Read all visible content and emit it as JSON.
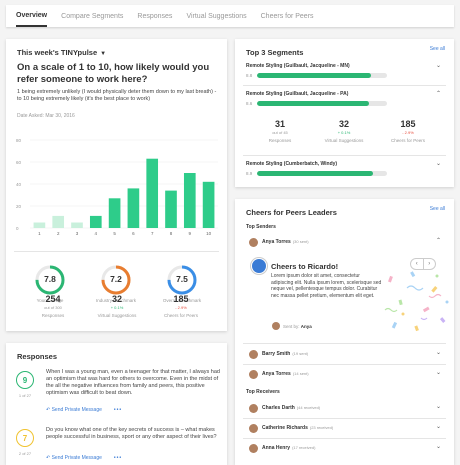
{
  "tabs": [
    "Overview",
    "Compare Segments",
    "Responses",
    "Virtual Suggestions",
    "Cheers for Peers"
  ],
  "pulse": {
    "header": "This week's TINYpulse",
    "question": "On a scale of 1 to 10, how likely would you refer someone to work here?",
    "scale_text": "1 being extremely unlikely (I would physically deter them down to my last breath) - to 10 being extremely likely (it's the best place to work)",
    "date_asked": "Date Asked: Mar 30, 2016",
    "y_ticks": [
      "80",
      "60",
      "40",
      "20",
      "0"
    ]
  },
  "chart_data": {
    "type": "bar",
    "categories": [
      "1",
      "2",
      "3",
      "4",
      "5",
      "6",
      "7",
      "8",
      "9",
      "10"
    ],
    "values": [
      5,
      11,
      5,
      11,
      27,
      36,
      63,
      34,
      50,
      42
    ],
    "ylim": [
      0,
      80
    ],
    "color": "#2ecc8a",
    "highlight_color": "#c9f0dc"
  },
  "gauges": [
    {
      "value": "7.8",
      "label": "Your Average",
      "color": "#2bb673"
    },
    {
      "value": "7.2",
      "label": "Industry Benchmark",
      "color": "#e87d30"
    },
    {
      "value": "7.5",
      "label": "Overall Benchmark",
      "color": "#3a8ee6"
    }
  ],
  "stats": [
    {
      "value": "254",
      "sub": "out of 300",
      "delta": "",
      "caption": "Responses"
    },
    {
      "value": "32",
      "sub": "",
      "delta": "+ 0.1%",
      "caption": "Virtual Suggestions"
    },
    {
      "value": "185",
      "sub": "",
      "delta": "- 2.9%",
      "caption": "Cheers for Peers"
    }
  ],
  "responses": {
    "title": "Responses",
    "items": [
      {
        "score": "9",
        "of": "1 of 27",
        "color": "#2bb673",
        "text": "When I was a young man, even a teenager for that matter, I always had an optimism that was hard for others to overcome. Even in the midst of the all the negative influences from family and peers, this positive optimism was difficult to beat down.",
        "action": "Send Private Message"
      },
      {
        "score": "7",
        "of": "2 of 27",
        "color": "#f0c330",
        "text": "Do you know what one of the key secrets of success is – what makes people successful in business, sport or any other aspect of their lives?",
        "action": "Send Private Message"
      }
    ]
  },
  "segments": {
    "title": "Top 3 Segments",
    "see_all": "See all",
    "items": [
      {
        "name": "Remote Styling (Guilbault, Jacqueline - MN)",
        "score": "8.8",
        "fill": 0.88
      },
      {
        "name": "Remote Styling (Guilbault, Jacqueline - PA)",
        "score": "8.6",
        "fill": 0.86
      },
      {
        "name": "Remote Styling (Cumberbatch, Windy)",
        "score": "8.9",
        "fill": 0.89
      }
    ],
    "expanded_stats": [
      {
        "value": "31",
        "sub": "out of 45",
        "delta": "",
        "caption": "Responses"
      },
      {
        "value": "32",
        "sub": "",
        "delta": "+ 0.1%",
        "caption": "Virtual Suggestions"
      },
      {
        "value": "185",
        "sub": "",
        "delta": "- 2.9%",
        "caption": "Cheers for Peers"
      }
    ]
  },
  "cheers": {
    "title": "Cheers for Peers Leaders",
    "see_all": "See all",
    "top_senders_label": "Top Senders",
    "top_receivers_label": "Top Receivers",
    "senders": [
      {
        "name": "Anya Torres",
        "count": "(30 sent)"
      },
      {
        "name": "Barry Smith",
        "count": "(19 sent)"
      },
      {
        "name": "Anya Torres",
        "count": "(14 sent)"
      }
    ],
    "receivers": [
      {
        "name": "Charles Darth",
        "count": "(44 received)"
      },
      {
        "name": "Catherine Richards",
        "count": "(23 received)"
      },
      {
        "name": "Anna Henry",
        "count": "(17 received)"
      }
    ],
    "card": {
      "heading": "Cheers to Ricardo!",
      "body": "Lorem ipsum dolor sit amet, consectetur adipiscing elit. Nulla ipsum lorem, scelerisque sed neque vel, pellentesque tempus dolor. Curabitur nec massa pellet pretium, elementum elit eget.",
      "sent_by_label": "Sent by:",
      "sent_by": "Anya"
    }
  }
}
